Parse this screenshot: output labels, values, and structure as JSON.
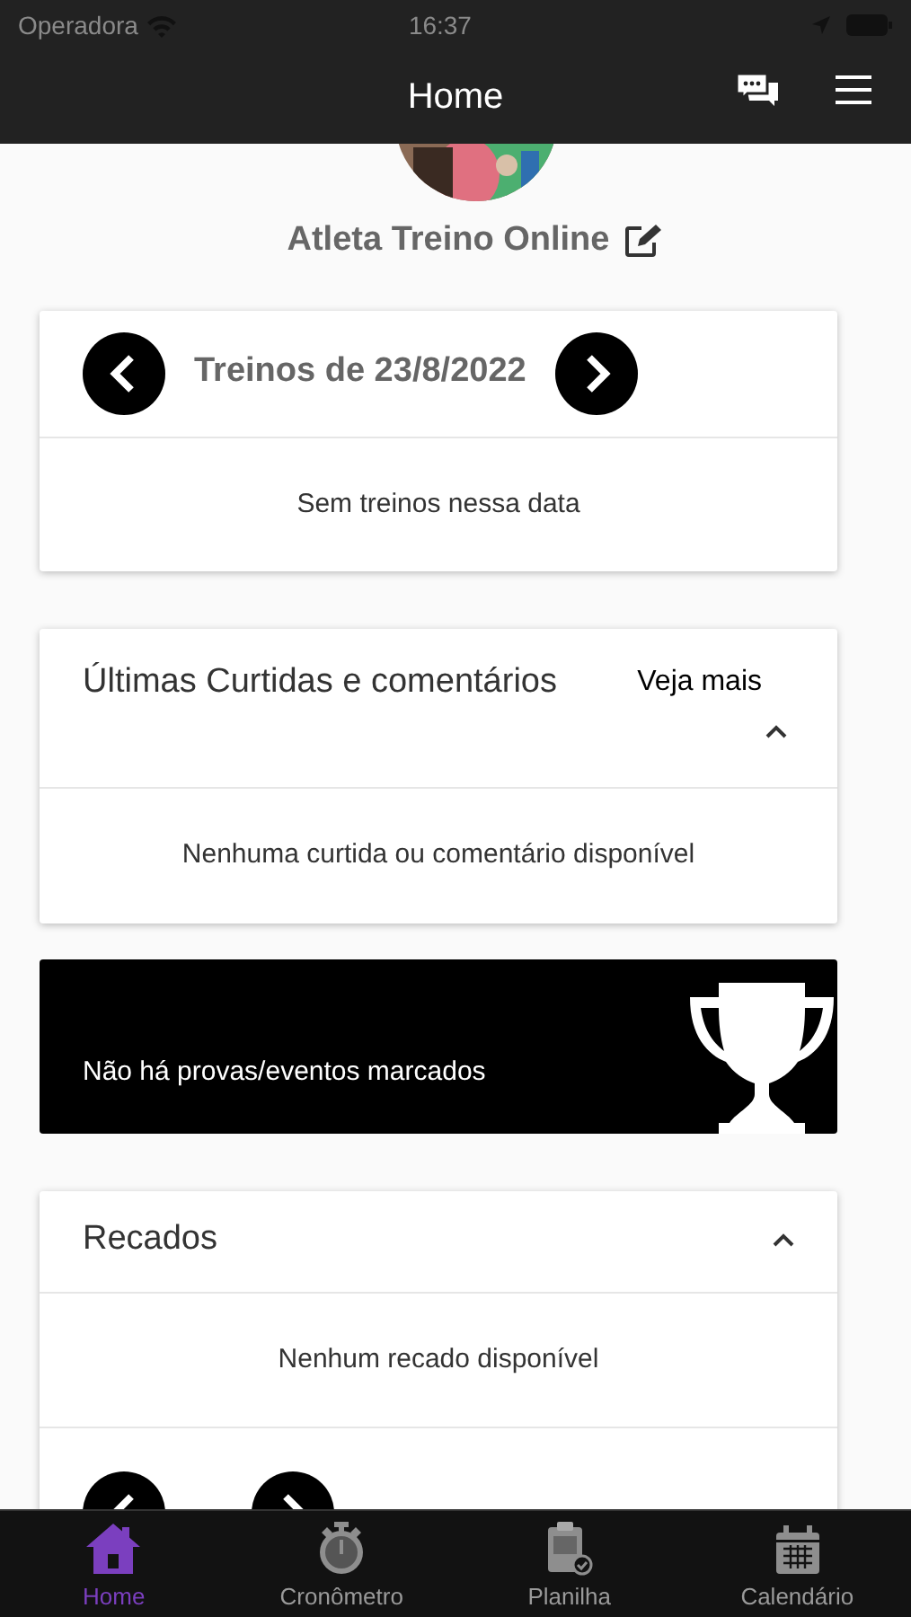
{
  "status_bar": {
    "carrier": "Operadora",
    "time": "16:37"
  },
  "header": {
    "title": "Home"
  },
  "profile": {
    "name": "Atleta Treino Online"
  },
  "trainings": {
    "title": "Treinos de 23/8/2022",
    "empty": "Sem treinos nessa data"
  },
  "likes": {
    "title": "Últimas Curtidas e comentários",
    "link": "Veja mais",
    "expanded": true,
    "empty": "Nenhuma curtida ou comentário disponível"
  },
  "events": {
    "text": "Não há provas/eventos marcados"
  },
  "messages": {
    "title": "Recados",
    "expanded": true,
    "empty": "Nenhum recado disponível"
  },
  "tabs": [
    {
      "kind": "home",
      "label": "Home",
      "selected": true
    },
    {
      "kind": "stopwatch",
      "label": "Cronômetro",
      "selected": false
    },
    {
      "kind": "clipboard",
      "label": "Planilha",
      "selected": false
    },
    {
      "kind": "calendar",
      "label": "Calendário",
      "selected": false
    }
  ]
}
